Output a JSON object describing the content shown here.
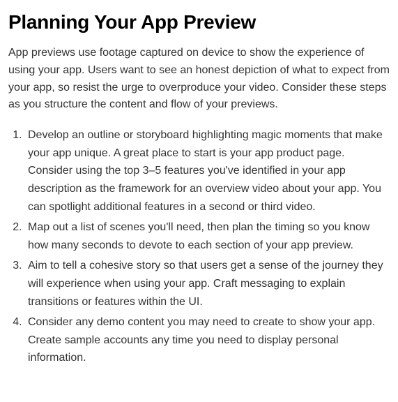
{
  "heading": "Planning Your App Preview",
  "intro": "App previews use footage captured on device to show the experience of using your app. Users want to see an honest depiction of what to expect from your app, so resist the urge to overproduce your video. Consider these steps as you structure the content and flow of your previews.",
  "steps": [
    "Develop an outline or storyboard highlighting magic moments that make your app unique. A great place to start is your app product page. Consider using the top 3–5 features you've identified in your app description as the framework for an overview video about your app. You can spotlight additional features in a second or third video.",
    "Map out a list of scenes you'll need, then plan the timing so you know how many seconds to devote to each section of your app preview.",
    "Aim to tell a cohesive story so that users get a sense of the journey they will experience when using your app. Craft messaging to explain transitions or features within the UI.",
    "Consider any demo content you may need to create to show your app. Create sample accounts any time you need to display personal information."
  ]
}
